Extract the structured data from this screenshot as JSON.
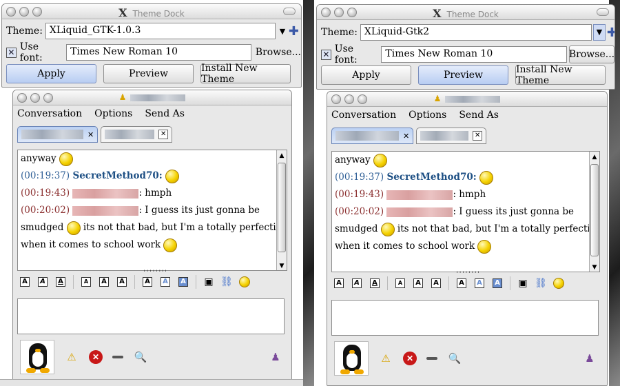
{
  "theme_dock": {
    "title": "Theme Dock",
    "theme_label": "Theme:",
    "font_label": "Use font:",
    "browse_label": "Browse...",
    "apply_label": "Apply",
    "preview_label": "Preview",
    "install_label": "Install New Theme",
    "left": {
      "theme_value": "XLiquid_GTK-1.0.3",
      "font_value": "Times New Roman 10"
    },
    "right": {
      "theme_value": "XLiquid-Gtk2",
      "font_value": "Times New Roman 10"
    }
  },
  "chat": {
    "menu": [
      "Conversation",
      "Options",
      "Send As"
    ],
    "messages": [
      {
        "text": "anyway"
      },
      {
        "time": "(00:19:37)",
        "nick": "SecretMethod70:"
      },
      {
        "time": "(00:19:43)",
        "text": ": hmph"
      },
      {
        "time": "(00:20:02)",
        "text": ": I guess its just gonna be"
      },
      {
        "text": "smudged"
      },
      {
        "text": " its not that bad, but I'm a totally perfectionist"
      },
      {
        "text": "when it comes to school work"
      }
    ],
    "format_buttons": [
      "A",
      "A",
      "A",
      "A",
      "A",
      "A",
      "A",
      "A",
      "A"
    ]
  },
  "colors": {
    "accent": "#2f5f96",
    "other_user": "#8b2f2f",
    "nick": "#1d4f84"
  },
  "icons": [
    "tux-icon",
    "warn-icon",
    "block-icon",
    "minimize-icon",
    "info-icon",
    "add-buddy-icon",
    "smiley-icon"
  ]
}
